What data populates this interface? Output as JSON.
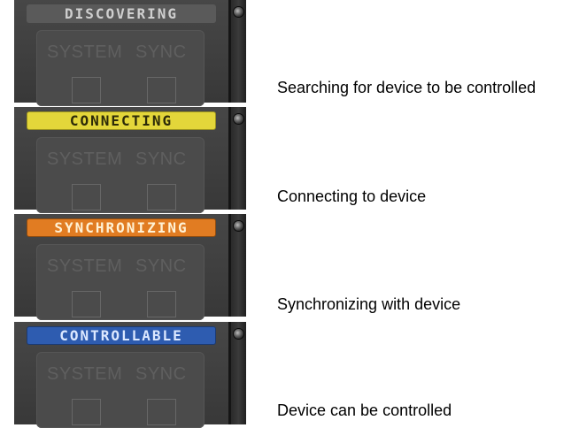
{
  "rows": [
    {
      "status_label": "DISCOVERING",
      "status_color": "#5a5a5a",
      "system_label": "SYSTEM",
      "sync_label": "SYNC",
      "description": "Searching for device to be controlled"
    },
    {
      "status_label": "CONNECTING",
      "status_color": "#e3d63a",
      "system_label": "SYSTEM",
      "sync_label": "SYNC",
      "description": "Connecting to device"
    },
    {
      "status_label": "SYNCHRONIZING",
      "status_color": "#e17c22",
      "system_label": "SYSTEM",
      "sync_label": "SYNC",
      "description": "Synchronizing with device"
    },
    {
      "status_label": "CONTROLLABLE",
      "status_color": "#2e5cb0",
      "system_label": "SYSTEM",
      "sync_label": "SYNC",
      "description": "Device can be controlled"
    }
  ],
  "icons": {
    "side_knob": "screw-knob-icon"
  }
}
